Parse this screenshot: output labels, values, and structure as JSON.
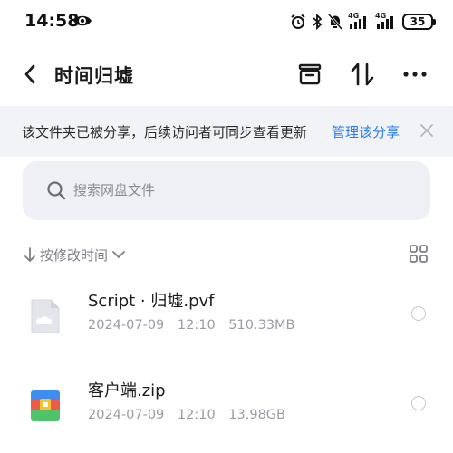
{
  "status_bar": {
    "time": "14:58",
    "battery": "35",
    "network_1": "4G",
    "network_2": "4G"
  },
  "header": {
    "title": "时间归墟",
    "icons": [
      "back-icon",
      "archive-icon",
      "sort-swap-icon",
      "more-icon"
    ]
  },
  "share_notice": {
    "text": "该文件夹已被分享，后续访问者可同步查看更新",
    "link": "管理该分享",
    "link_color": "#2b7cf0"
  },
  "search": {
    "placeholder": "搜索网盘文件",
    "value": ""
  },
  "sort": {
    "label": "按修改时间"
  },
  "files": [
    {
      "name": "Script · 归墟.pvf",
      "date": "2024-07-09",
      "time": "12:10",
      "size": "510.33MB",
      "icon": "cloud-file-icon"
    },
    {
      "name": "客户端.zip",
      "date": "2024-07-09",
      "time": "12:10",
      "size": "13.98GB",
      "icon": "zip-archive-icon"
    }
  ]
}
